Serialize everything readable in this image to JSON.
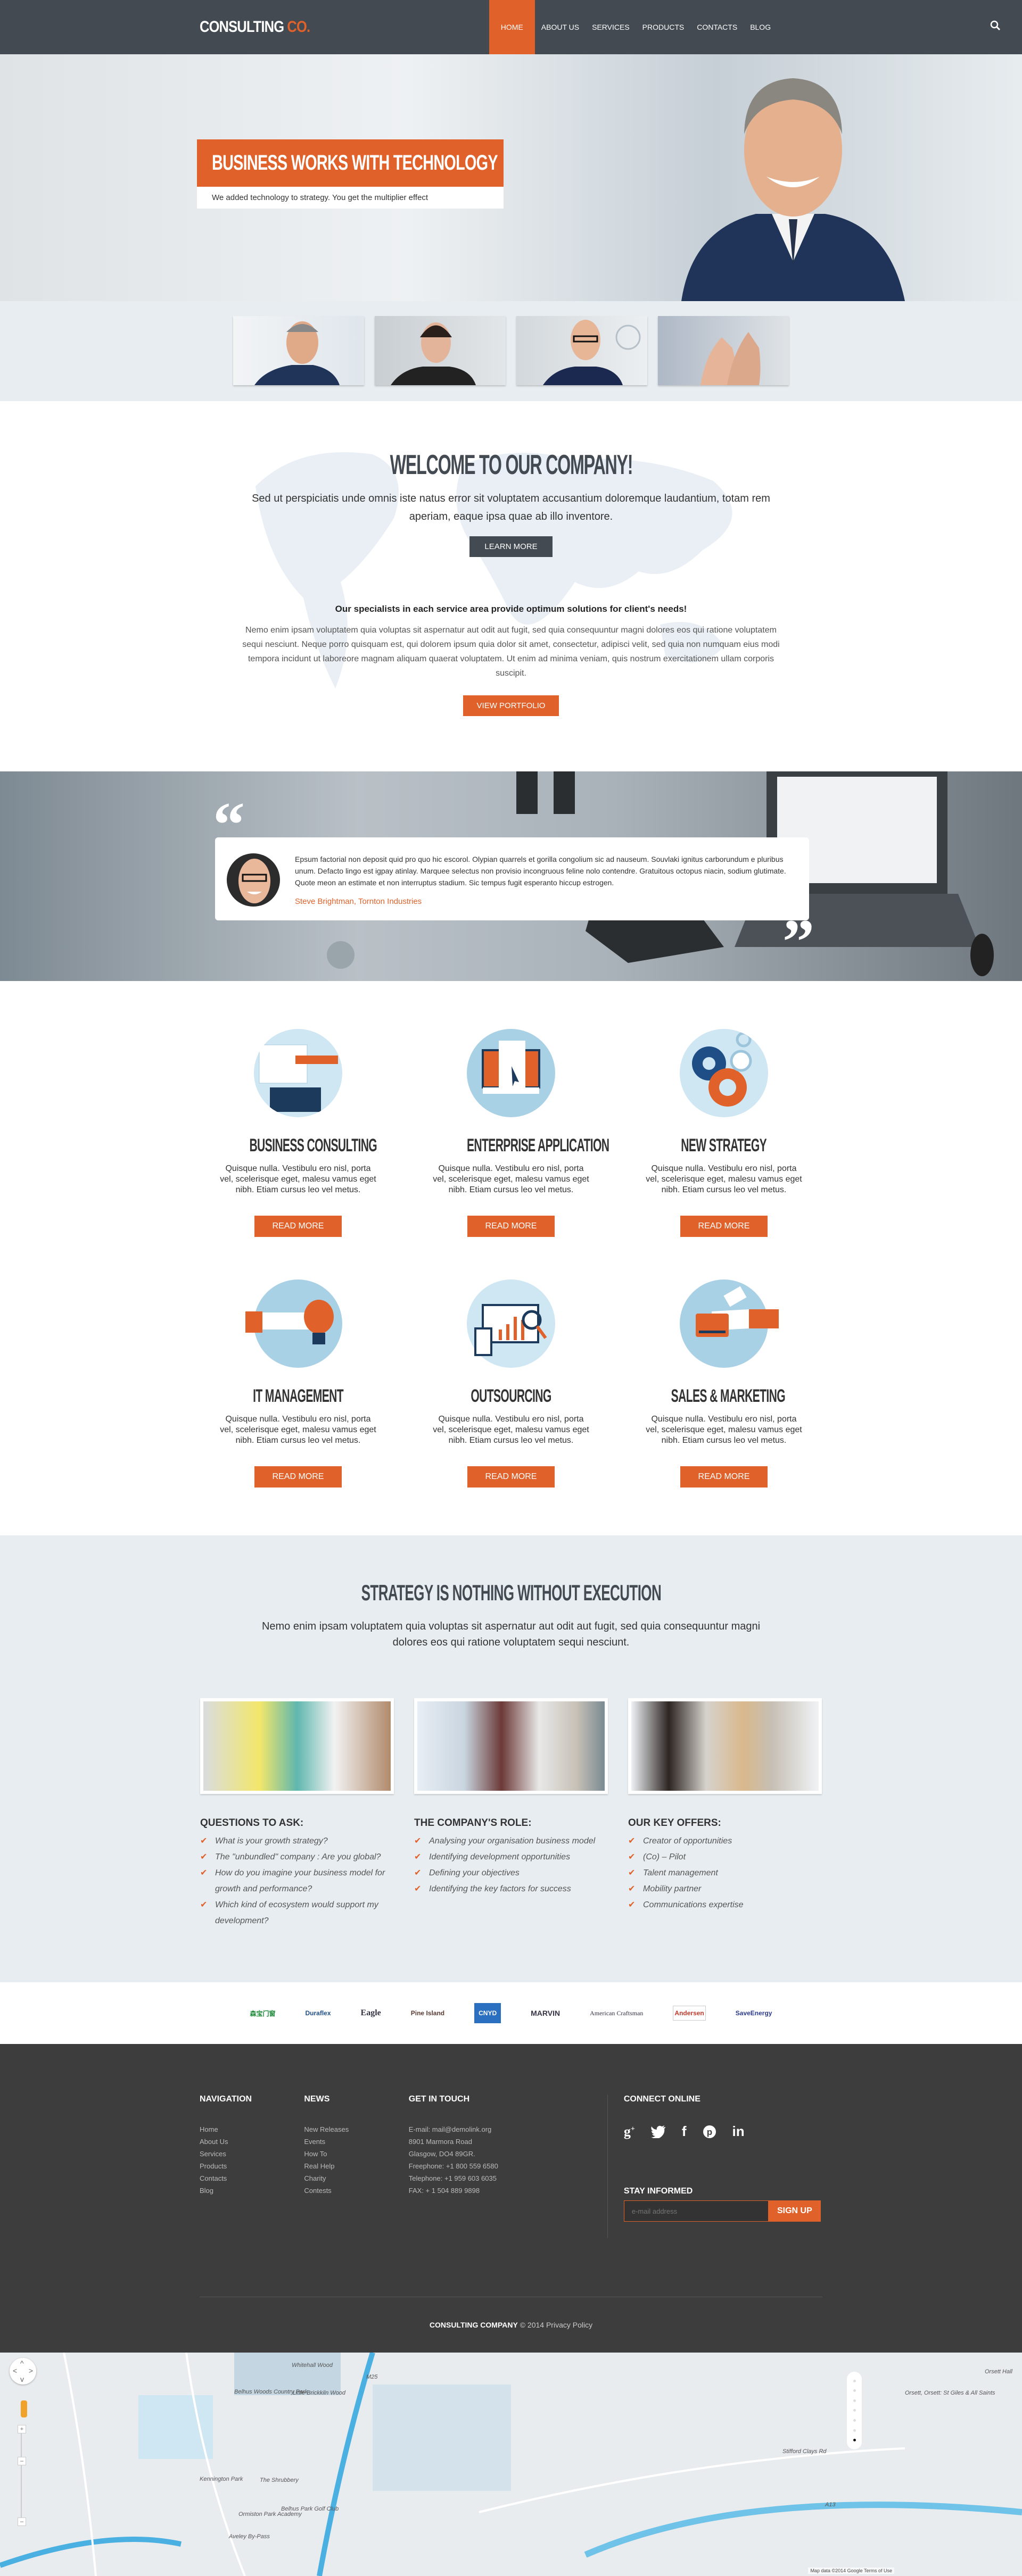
{
  "header": {
    "logo_main": "CONSULTING",
    "logo_accent": "CO.",
    "nav": [
      {
        "label": "HOME",
        "active": true
      },
      {
        "label": "ABOUT US"
      },
      {
        "label": "SERVICES"
      },
      {
        "label": "PRODUCTS"
      },
      {
        "label": "CONTACTS"
      },
      {
        "label": "BLOG"
      }
    ],
    "search_icon": "search-icon"
  },
  "hero": {
    "title": "BUSINESS WORKS WITH TECHNOLOGY",
    "subtitle": "We added technology to strategy. You get the multiplier effect"
  },
  "thumbnails": [
    "businessman",
    "woman on phone",
    "woman with glasses",
    "thumbs up"
  ],
  "welcome": {
    "title": "WELCOME TO OUR COMPANY!",
    "text": "Sed ut perspiciatis unde omnis iste natus error sit voluptatem accusantium doloremque laudantium, totam rem aperiam, eaque ipsa quae ab illo inventore.",
    "learn_more": "LEARN MORE",
    "subheading": "Our specialists in each service area provide optimum solutions for client's needs!",
    "body": "Nemo enim ipsam voluptatem quia voluptas sit aspernatur aut odit aut fugit, sed quia consequuntur magni dolores eos qui ratione voluptatem sequi nesciunt. Neque porro quisquam est, qui dolorem ipsum quia dolor sit amet, consectetur, adipisci velit, sed quia non numquam eius modi tempora incidunt ut laboreore magnam aliquam quaerat voluptatem. Ut enim ad minima veniam, quis nostrum exercitationem ullam corporis suscipit.",
    "view_portfolio": "VIEW PORTFOLIO"
  },
  "testimonial": {
    "text": "Epsum factorial non deposit quid pro quo hic escorol. Olypian quarrels et gorilla congolium sic ad nauseum. Souvlaki ignitus carborundum e pluribus unum. Defacto lingo est igpay atinlay. Marquee selectus non provisio incongruous feline nolo contendre. Gratuitous octopus niacin, sodium glutimate. Quote meon an estimate et non interruptus stadium. Sic tempus fugit esperanto hiccup estrogen.",
    "author": "Steve Brightman, Tornton Industries"
  },
  "services": {
    "description": "Quisque nulla. Vestibulu ero nisl, porta vel, scelerisque eget, malesu vamus eget nibh. Etiam cursus leo vel metus.",
    "button": "READ MORE",
    "items": [
      {
        "title": "BUSINESS CONSULTING",
        "icon": "keyboard-pen-icon"
      },
      {
        "title": "ENTERPRISE APPLICATION",
        "icon": "monitor-document-icon"
      },
      {
        "title": "NEW STRATEGY",
        "icon": "gears-icon"
      },
      {
        "title": "IT MANAGEMENT",
        "icon": "lightbulb-hand-icon"
      },
      {
        "title": "OUTSOURCING",
        "icon": "analytics-magnifier-icon"
      },
      {
        "title": "SALES & MARKETING",
        "icon": "credit-card-hand-icon"
      }
    ]
  },
  "strategy": {
    "title": "STRATEGY IS NOTHING WITHOUT EXECUTION",
    "text": "Nemo enim ipsam voluptatem quia voluptas sit aspernatur aut odit aut fugit, sed quia consequuntur magni dolores eos qui ratione voluptatem sequi nesciunt.",
    "columns": [
      {
        "heading": "QUESTIONS TO ASK:",
        "items": [
          "What is your growth strategy?",
          "The \"unbundled\" company : Are you global?",
          "How do you imagine your business model for growth and performance?",
          "Which kind of ecosystem would support my development?"
        ]
      },
      {
        "heading": "THE COMPANY'S ROLE:",
        "items": [
          "Analysing your organisation business model",
          "Identifying development opportunities",
          "Defining your objectives",
          "Identifying the key factors for success"
        ]
      },
      {
        "heading": "OUR KEY OFFERS:",
        "items": [
          "Creator of opportunities",
          "(Co) – Pilot",
          "Talent management",
          "Mobility partner",
          "Communications expertise"
        ]
      }
    ]
  },
  "brands": [
    "森宝门窗",
    "Duraflex",
    "Eagle",
    "Pine Island",
    "CNYD",
    "MARVIN",
    "American Craftsman",
    "Andersen",
    "SaveEnergy"
  ],
  "footer": {
    "navigation": {
      "heading": "NAVIGATION",
      "links": [
        "Home",
        "About Us",
        "Services",
        "Products",
        "Contacts",
        "Blog"
      ]
    },
    "news": {
      "heading": "NEWS",
      "links": [
        "New Releases",
        "Events",
        "How To",
        "Real Help",
        "Charity",
        "Contests"
      ]
    },
    "contact": {
      "heading": "GET IN TOUCH",
      "lines": [
        "E-mail: mail@demolink.org",
        "8901 Marmora Road",
        "Glasgow, DO4 89GR.",
        "Freephone:  +1 800 559 6580",
        "Telephone:  +1 959 603 6035",
        "FAX:        + 1 504 889 9898"
      ]
    },
    "connect": {
      "heading": "CONNECT ONLINE",
      "icons": [
        "g+",
        "twitter",
        "f",
        "pinterest",
        "in"
      ]
    },
    "stay": {
      "heading": "STAY INFORMED",
      "placeholder": "e-mail address",
      "button": "SIGN UP"
    },
    "copyright_brand": "CONSULTING COMPANY",
    "copyright_rest": "© 2014 Privacy Policy"
  },
  "map": {
    "labels": [
      "Belhus Woods Country Park",
      "Whitehall Wood",
      "Little Brickkiln Wood",
      "Kennington Park",
      "The Shrubbery",
      "Ormiston Park Academy",
      "Belhus Park Golf Club",
      "Aveley By-Pass",
      "Orsett, Orsett: St Giles & All Saints",
      "Orsett Hall",
      "Stifford Clays Rd",
      "A13",
      "M25"
    ],
    "attribution": "Map data ©2014 Google   Terms of Use"
  },
  "colors": {
    "accent": "#e0622a",
    "dark": "#434a52",
    "footer": "#3d3d3d",
    "light_bg": "#e8edf1"
  }
}
